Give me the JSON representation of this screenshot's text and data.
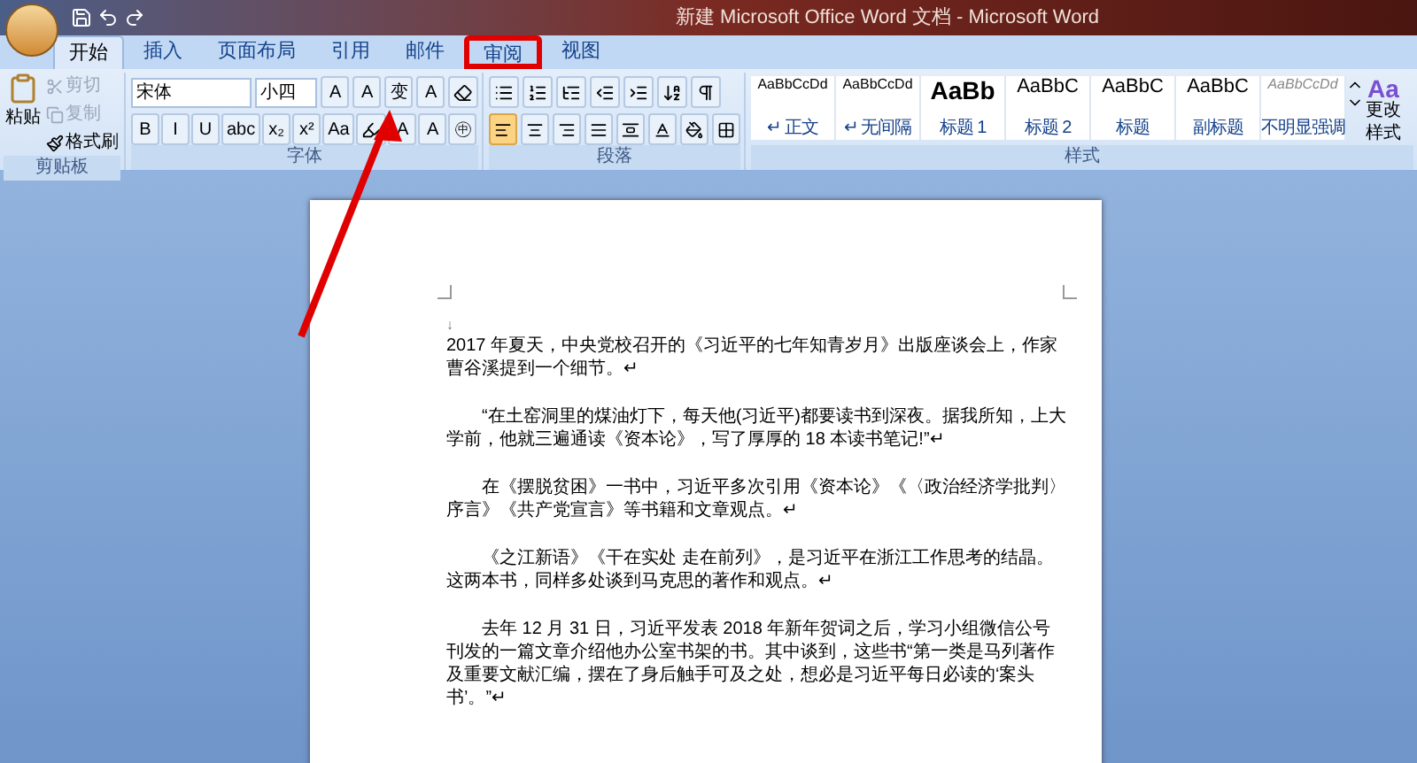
{
  "window": {
    "title": "新建 Microsoft Office Word 文档 - Microsoft Word"
  },
  "tabs": [
    {
      "label": "开始",
      "selected": true,
      "highlighted": false
    },
    {
      "label": "插入",
      "selected": false,
      "highlighted": false
    },
    {
      "label": "页面布局",
      "selected": false,
      "highlighted": false
    },
    {
      "label": "引用",
      "selected": false,
      "highlighted": false
    },
    {
      "label": "邮件",
      "selected": false,
      "highlighted": false
    },
    {
      "label": "审阅",
      "selected": false,
      "highlighted": true
    },
    {
      "label": "视图",
      "selected": false,
      "highlighted": false
    }
  ],
  "clipboard": {
    "group_label": "剪贴板",
    "paste": "粘贴",
    "items": [
      {
        "kind": "cut",
        "label": "剪切",
        "disabled": true
      },
      {
        "kind": "copy",
        "label": "复制",
        "disabled": true
      },
      {
        "kind": "brush",
        "label": "格式刷",
        "disabled": false
      }
    ]
  },
  "font": {
    "group_label": "字体",
    "font_name": "宋体",
    "font_size": "小四",
    "row1": [
      "A",
      "A",
      "变",
      "A"
    ],
    "row2": [
      "B",
      "I",
      "U",
      "abc",
      "x₂",
      "x²",
      "Aa"
    ],
    "row2_after": [
      "A",
      "A",
      "㊥"
    ]
  },
  "paragraph": {
    "group_label": "段落",
    "alignments": [
      {
        "kind": "left",
        "selected": true
      },
      {
        "kind": "center",
        "selected": false
      },
      {
        "kind": "right",
        "selected": false
      },
      {
        "kind": "justify",
        "selected": false
      },
      {
        "kind": "distributed",
        "selected": false
      }
    ]
  },
  "styles": {
    "group_label": "样式",
    "items": [
      {
        "preview": "AaBbCcDd",
        "label": "↵ 正文",
        "kind": "normal"
      },
      {
        "preview": "AaBbCcDd",
        "label": "↵ 无间隔",
        "kind": "normal"
      },
      {
        "preview": "AaBb",
        "label": "标题 1",
        "kind": "heading1"
      },
      {
        "preview": "AaBbC",
        "label": "标题 2",
        "kind": "heading2"
      },
      {
        "preview": "AaBbC",
        "label": "标题",
        "kind": "heading2"
      },
      {
        "preview": "AaBbC",
        "label": "副标题",
        "kind": "heading2"
      },
      {
        "preview": "AaBbCcDd",
        "label": "不明显强调",
        "kind": "subtle"
      }
    ],
    "change_styles_glyph": "Aa",
    "change_styles": "更改样式"
  },
  "document": {
    "top_mark": "↓",
    "paragraphs": [
      {
        "text": "2017 年夏天，中央党校召开的《习近平的七年知青岁月》出版座谈会上，作家曹谷溪提到一个细节。↵",
        "indent": false
      },
      {
        "text": "“在土窑洞里的煤油灯下，每天他(习近平)都要读书到深夜。据我所知，上大学前，他就三遍通读《资本论》，写了厚厚的 18 本读书笔记!”↵",
        "indent": true
      },
      {
        "text": "在《摆脱贫困》一书中，习近平多次引用《资本论》《〈政治经济学批判〉序言》《共产党宣言》等书籍和文章观点。↵",
        "indent": true
      },
      {
        "text": "《之江新语》《干在实处 走在前列》，是习近平在浙江工作思考的结晶。这两本书，同样多处谈到马克思的著作和观点。↵",
        "indent": true
      },
      {
        "text": "去年 12 月 31 日，习近平发表 2018 年新年贺词之后，学习小组微信公号刊发的一篇文章介绍他办公室书架的书。其中谈到，这些书“第一类是马列著作及重要文献汇编，摆在了身后触手可及之处，想必是习近平每日必读的‘案头书’。”↵",
        "indent": true
      }
    ]
  }
}
